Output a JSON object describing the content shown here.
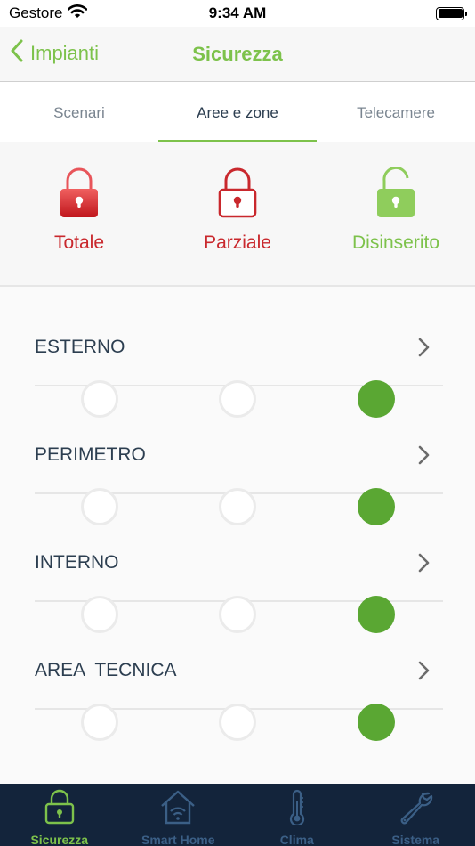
{
  "status_bar": {
    "carrier": "Gestore",
    "time": "9:34 AM"
  },
  "nav": {
    "back_label": "Impianti",
    "title": "Sicurezza"
  },
  "tabs": [
    {
      "label": "Scenari",
      "active": false
    },
    {
      "label": "Aree e zone",
      "active": true
    },
    {
      "label": "Telecamere",
      "active": false
    }
  ],
  "modes": [
    {
      "label": "Totale",
      "icon": "lock-closed-filled-icon"
    },
    {
      "label": "Parziale",
      "icon": "lock-closed-outline-icon"
    },
    {
      "label": "Disinserito",
      "icon": "lock-open-icon"
    }
  ],
  "zones": [
    {
      "name": "ESTERNO",
      "selected_stop": 3
    },
    {
      "name": "PERIMETRO",
      "selected_stop": 3
    },
    {
      "name": "INTERNO",
      "selected_stop": 3
    },
    {
      "name": "AREA  TECNICA",
      "selected_stop": 3
    }
  ],
  "tab_bar": [
    {
      "label": "Sicurezza",
      "icon": "lock-icon",
      "active": true
    },
    {
      "label": "Smart Home",
      "icon": "smart-home-icon",
      "active": false
    },
    {
      "label": "Clima",
      "icon": "thermometer-icon",
      "active": false
    },
    {
      "label": "Sistema",
      "icon": "wrench-icon",
      "active": false
    }
  ],
  "colors": {
    "accent_green": "#7dc24b",
    "alarm_red": "#c9282d",
    "active_stop": "#5aa733",
    "tab_bar_bg": "#13243b",
    "tab_bar_inactive": "#3b5f86"
  }
}
